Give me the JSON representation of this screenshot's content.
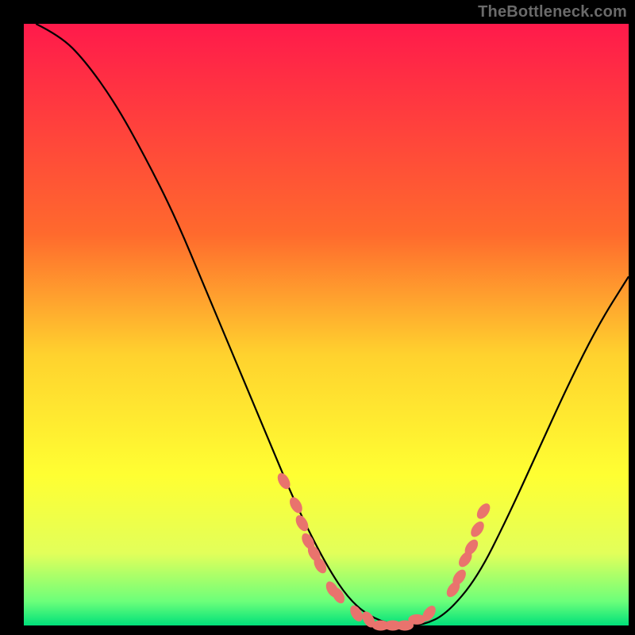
{
  "watermark": "TheBottleneck.com",
  "chart_data": {
    "type": "line",
    "title": "",
    "xlabel": "",
    "ylabel": "",
    "xlim": [
      0,
      100
    ],
    "ylim": [
      0,
      100
    ],
    "background_gradient_stops": [
      {
        "offset": 0,
        "color": "#ff1a4b"
      },
      {
        "offset": 35,
        "color": "#ff6a2d"
      },
      {
        "offset": 55,
        "color": "#ffd22e"
      },
      {
        "offset": 75,
        "color": "#ffff32"
      },
      {
        "offset": 88,
        "color": "#e2ff5a"
      },
      {
        "offset": 96,
        "color": "#6cff7a"
      },
      {
        "offset": 100,
        "color": "#00e07a"
      }
    ],
    "series": [
      {
        "name": "curve",
        "color": "#000000",
        "x": [
          2,
          6,
          10,
          15,
          20,
          25,
          30,
          35,
          40,
          45,
          50,
          54,
          58,
          62,
          66,
          70,
          75,
          80,
          85,
          90,
          95,
          100
        ],
        "y": [
          100,
          98,
          94,
          87,
          78,
          68,
          56,
          44,
          32,
          20,
          10,
          4,
          1,
          0,
          0,
          2,
          8,
          18,
          29,
          40,
          50,
          58
        ]
      }
    ],
    "scatter": {
      "name": "optimal-zone-markers",
      "color": "#e9736d",
      "points": [
        {
          "x": 43,
          "y": 24
        },
        {
          "x": 45,
          "y": 20
        },
        {
          "x": 46,
          "y": 17
        },
        {
          "x": 47,
          "y": 14
        },
        {
          "x": 48,
          "y": 12
        },
        {
          "x": 49,
          "y": 10
        },
        {
          "x": 51,
          "y": 6
        },
        {
          "x": 52,
          "y": 5
        },
        {
          "x": 55,
          "y": 2
        },
        {
          "x": 57,
          "y": 1
        },
        {
          "x": 59,
          "y": 0
        },
        {
          "x": 61,
          "y": 0
        },
        {
          "x": 63,
          "y": 0
        },
        {
          "x": 65,
          "y": 1
        },
        {
          "x": 67,
          "y": 2
        },
        {
          "x": 71,
          "y": 6
        },
        {
          "x": 72,
          "y": 8
        },
        {
          "x": 73,
          "y": 11
        },
        {
          "x": 74,
          "y": 13
        },
        {
          "x": 75,
          "y": 16
        },
        {
          "x": 76,
          "y": 19
        }
      ]
    }
  }
}
